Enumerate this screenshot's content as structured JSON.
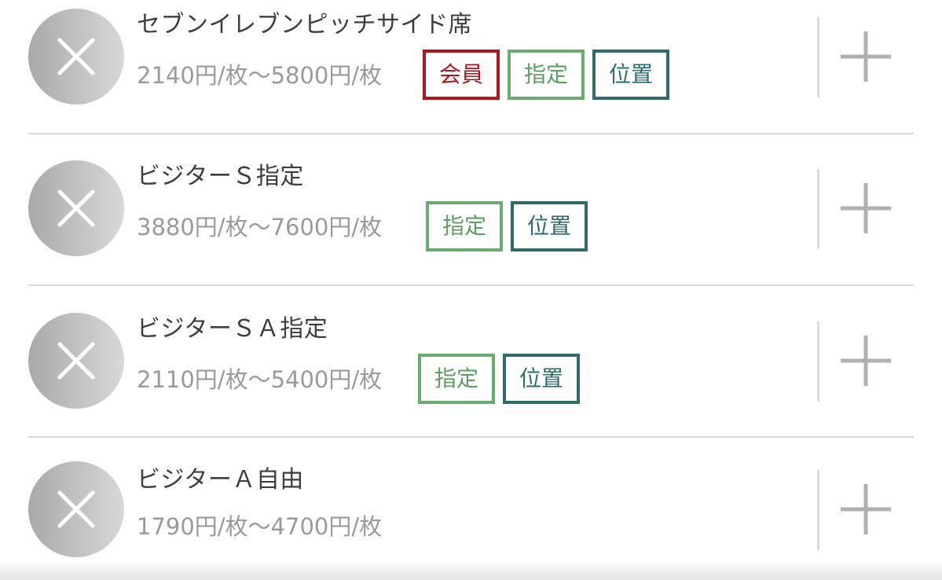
{
  "seats": [
    {
      "name": "セブンイレブンピッチサイド席",
      "price": "2140円/枚〜5800円/枚",
      "tags": [
        {
          "label": "会員",
          "kind": "member"
        },
        {
          "label": "指定",
          "kind": "reserved"
        },
        {
          "label": "位置",
          "kind": "position"
        }
      ]
    },
    {
      "name": "ビジターＳ指定",
      "price": "3880円/枚〜7600円/枚",
      "tags": [
        {
          "label": "指定",
          "kind": "reserved"
        },
        {
          "label": "位置",
          "kind": "position"
        }
      ]
    },
    {
      "name": "ビジターＳＡ指定",
      "price": "2110円/枚〜5400円/枚",
      "tags": [
        {
          "label": "指定",
          "kind": "reserved"
        },
        {
          "label": "位置",
          "kind": "position"
        }
      ]
    },
    {
      "name": "ビジターＡ自由",
      "price": "1790円/枚〜4700円/枚",
      "tags": []
    }
  ],
  "icons": {
    "remove": "close-icon",
    "add": "plus-icon"
  },
  "colors": {
    "member_tag": "#b5121b",
    "reserved_tag": "#6aac6e",
    "position_tag": "#2f6b6a",
    "remove_button": "#b8b8b8",
    "add_icon": "#b0b0b0"
  }
}
